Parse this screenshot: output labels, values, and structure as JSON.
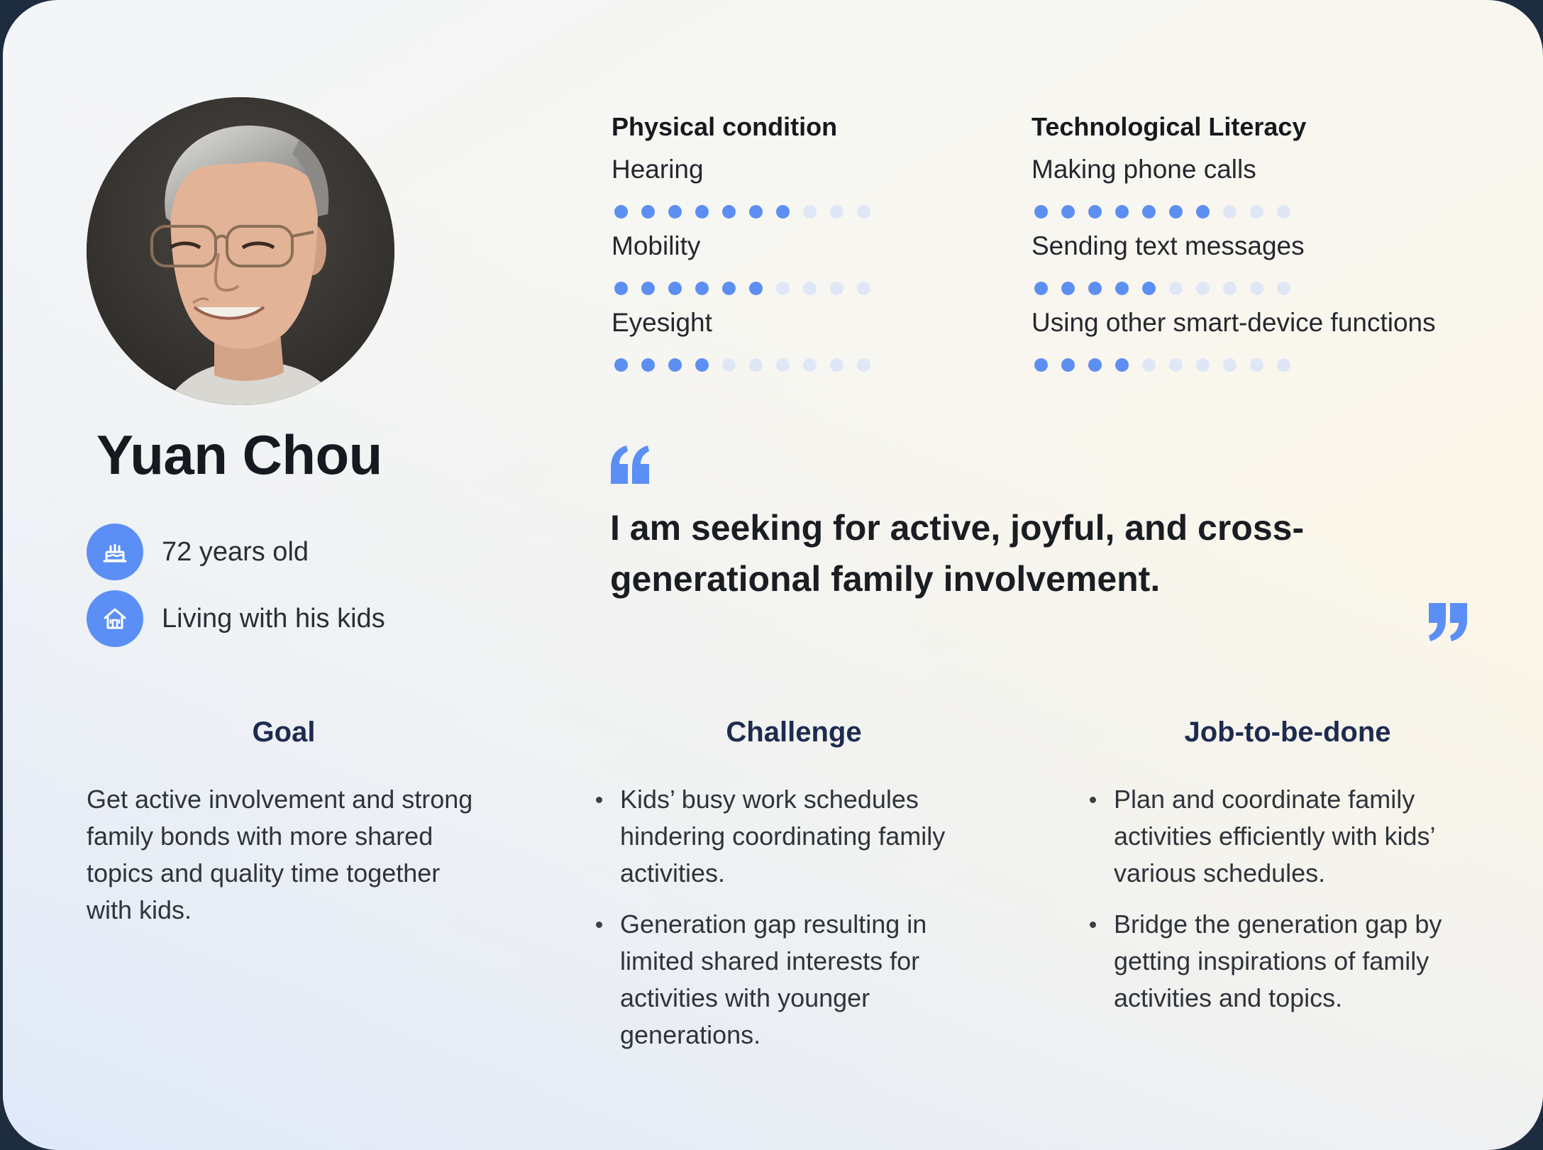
{
  "persona": {
    "name": "Yuan Chou",
    "age": "72 years old",
    "living": "Living with his kids"
  },
  "physical": {
    "heading": "Physical condition",
    "items": [
      {
        "label": "Hearing",
        "level": 7,
        "max": 10
      },
      {
        "label": "Mobility",
        "level": 6,
        "max": 10
      },
      {
        "label": "Eyesight",
        "level": 4,
        "max": 10
      }
    ]
  },
  "tech": {
    "heading": "Technological Literacy",
    "items": [
      {
        "label": "Making phone calls",
        "level": 7,
        "max": 10
      },
      {
        "label": "Sending text messages",
        "level": 5,
        "max": 10
      },
      {
        "label": "Using other smart-device functions",
        "level": 4,
        "max": 10
      }
    ]
  },
  "quote": {
    "line1": "I am seeking for active, joyful, and cross-",
    "line2": "generational family involvement."
  },
  "goal": {
    "title": "Goal",
    "text": "Get active involvement and strong family bonds with more shared topics and quality time together with kids."
  },
  "challenge": {
    "title": "Challenge",
    "bullets": [
      "Kids’ busy work schedules hindering coordinating family activities.",
      "Generation gap resulting in limited shared interests for activities with younger generations."
    ]
  },
  "job": {
    "title": "Job-to-be-done",
    "bullets": [
      "Plan and coordinate family activities efficiently with kids’ various schedules.",
      "Bridge the generation gap by getting inspirations of family activities and topics."
    ]
  },
  "colors": {
    "accent": "#5b8ff5",
    "dot_on": "#5d8ff2",
    "dot_off": "#dfe7f7",
    "column_title": "#1d2b4f"
  },
  "icons": [
    "cake-icon",
    "house-icon",
    "quote-open-icon",
    "quote-close-icon"
  ]
}
